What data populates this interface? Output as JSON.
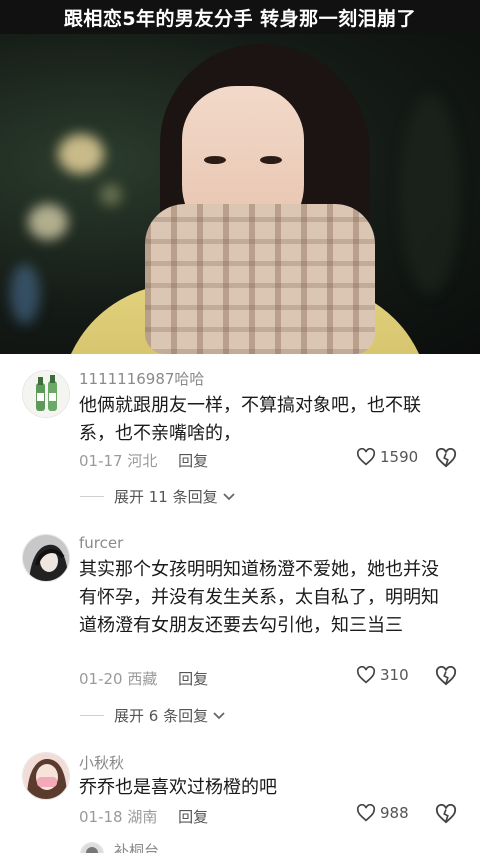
{
  "banner": {
    "title": "跟相恋5年的男友分手 转身那一刻泪崩了"
  },
  "comments": [
    {
      "username": "1111116987哈哈",
      "text": "他俩就跟朋友一样，不算搞对象吧，也不联系，也不亲嘴啥的，",
      "date": "01-17",
      "location": "河北",
      "reply_label": "回复",
      "likes": "1590",
      "expand_label": "展开 11 条回复"
    },
    {
      "username": "furcer",
      "text": "其实那个女孩明明知道杨澄不爱她，她也并没有怀孕，并没有发生关系，太自私了，明明知道杨澄有女朋友还要去勾引他，知三当三",
      "date": "01-20",
      "location": "西藏",
      "reply_label": "回复",
      "likes": "310",
      "expand_label": "展开 6 条回复"
    },
    {
      "username": "小秋秋",
      "text": "乔乔也是喜欢过杨橙的吧",
      "date": "01-18",
      "location": "湖南",
      "reply_label": "回复",
      "likes": "988"
    },
    {
      "username": "补桐台"
    }
  ],
  "icons": {
    "like": "heart-outline-icon",
    "dislike": "broken-heart-icon",
    "expand": "chevron-down-icon"
  },
  "colors": {
    "banner_bg": "#111111",
    "username": "#8a8a8a",
    "meta": "#9a9a9a"
  }
}
